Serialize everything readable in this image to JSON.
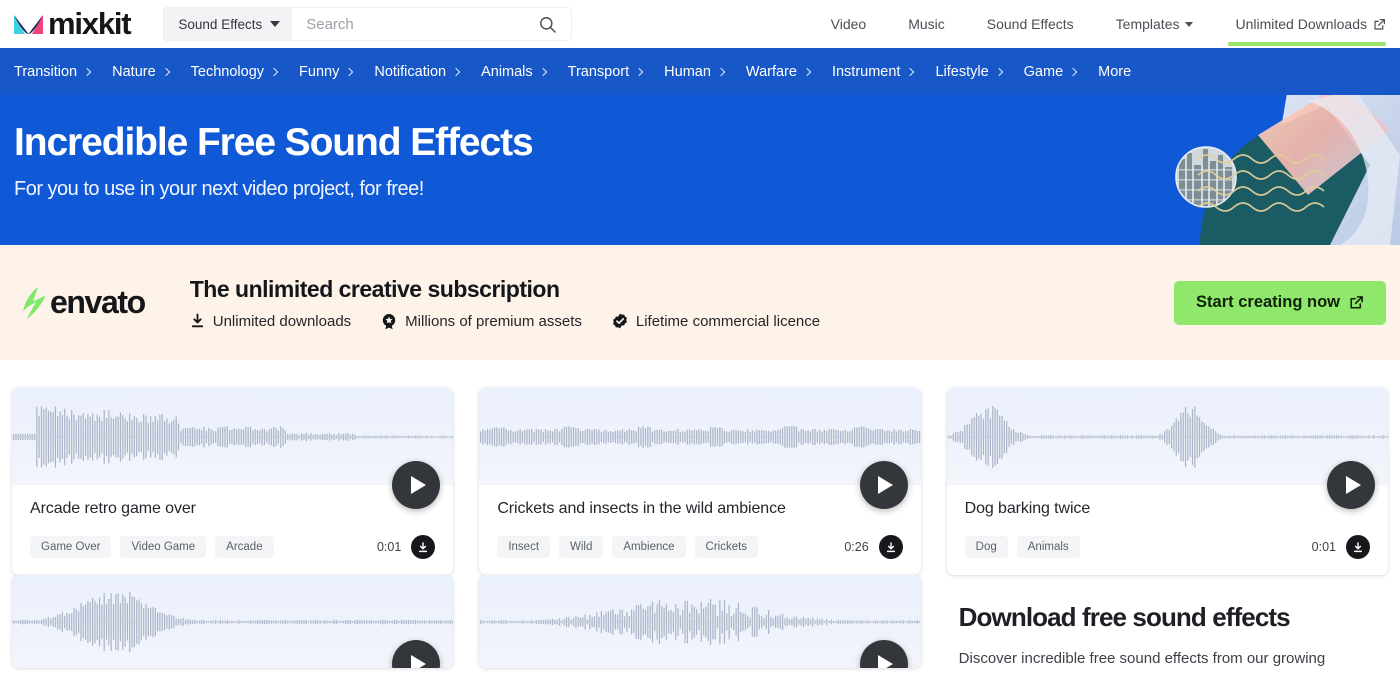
{
  "theme": {
    "nav_blue": "#1757c7",
    "hero_blue": "#1059d6",
    "accent_green": "#8fe86b",
    "underline_green": "#9ae46a",
    "envato_bg": "#fdf3e8",
    "card_wave_bg": "#eaf0fc",
    "dark_button": "#33363b"
  },
  "header": {
    "logo_text": "mixkit",
    "logo_icon": "mixkit-m-mark-icon",
    "search": {
      "category_label": "Sound Effects",
      "category_caret_icon": "chevron-down-icon",
      "placeholder": "Search",
      "value": "",
      "icon": "search-icon"
    },
    "nav": [
      {
        "label": "Video",
        "caret": false,
        "external": false,
        "underlined": false
      },
      {
        "label": "Music",
        "caret": false,
        "external": false,
        "underlined": false
      },
      {
        "label": "Sound Effects",
        "caret": false,
        "external": false,
        "underlined": false
      },
      {
        "label": "Templates",
        "caret": true,
        "external": false,
        "underlined": false
      },
      {
        "label": "Unlimited Downloads",
        "caret": false,
        "external": true,
        "underlined": true
      }
    ]
  },
  "categories": [
    {
      "label": "Transition",
      "chevron": true
    },
    {
      "label": "Nature",
      "chevron": true
    },
    {
      "label": "Technology",
      "chevron": true
    },
    {
      "label": "Funny",
      "chevron": true
    },
    {
      "label": "Notification",
      "chevron": true
    },
    {
      "label": "Animals",
      "chevron": true
    },
    {
      "label": "Transport",
      "chevron": true
    },
    {
      "label": "Human",
      "chevron": true
    },
    {
      "label": "Warfare",
      "chevron": true
    },
    {
      "label": "Instrument",
      "chevron": true
    },
    {
      "label": "Lifestyle",
      "chevron": true
    },
    {
      "label": "Game",
      "chevron": true
    },
    {
      "label": "More",
      "chevron": false
    }
  ],
  "hero": {
    "title": "Incredible Free Sound Effects",
    "subtitle": "For you to use in your next video project, for free!",
    "art": "abstract-sound-wave-illustration"
  },
  "envato": {
    "brand": "envato",
    "brand_icon": "envato-bolt-icon",
    "headline": "The unlimited creative subscription",
    "features": [
      {
        "label": "Unlimited downloads",
        "icon": "download-icon"
      },
      {
        "label": "Millions of premium assets",
        "icon": "badge-star-icon"
      },
      {
        "label": "Lifetime commercial licence",
        "icon": "check-badge-icon"
      }
    ],
    "cta_label": "Start creating now",
    "cta_icon": "external-link-icon"
  },
  "cards": [
    {
      "title": "Arcade retro game over",
      "tags": [
        "Game Over",
        "Video Game",
        "Arcade"
      ],
      "duration": "0:01",
      "play_icon": "play-icon",
      "download_icon": "download-icon",
      "waveform": "arcade-retro-game-over-waveform"
    },
    {
      "title": "Crickets and insects in the wild ambience",
      "tags": [
        "Insect",
        "Wild",
        "Ambience",
        "Crickets"
      ],
      "duration": "0:26",
      "play_icon": "play-icon",
      "download_icon": "download-icon",
      "waveform": "crickets-ambience-waveform"
    },
    {
      "title": "Dog barking twice",
      "tags": [
        "Dog",
        "Animals"
      ],
      "duration": "0:01",
      "play_icon": "play-icon",
      "download_icon": "download-icon",
      "waveform": "dog-barking-twice-waveform"
    }
  ],
  "cards_partial": [
    {
      "waveform": "partial-card-1-waveform",
      "play_icon": "play-icon"
    },
    {
      "waveform": "partial-card-2-waveform",
      "play_icon": "play-icon"
    }
  ],
  "promo": {
    "title": "Download free sound effects",
    "description": "Discover incredible free sound effects from our growing"
  }
}
